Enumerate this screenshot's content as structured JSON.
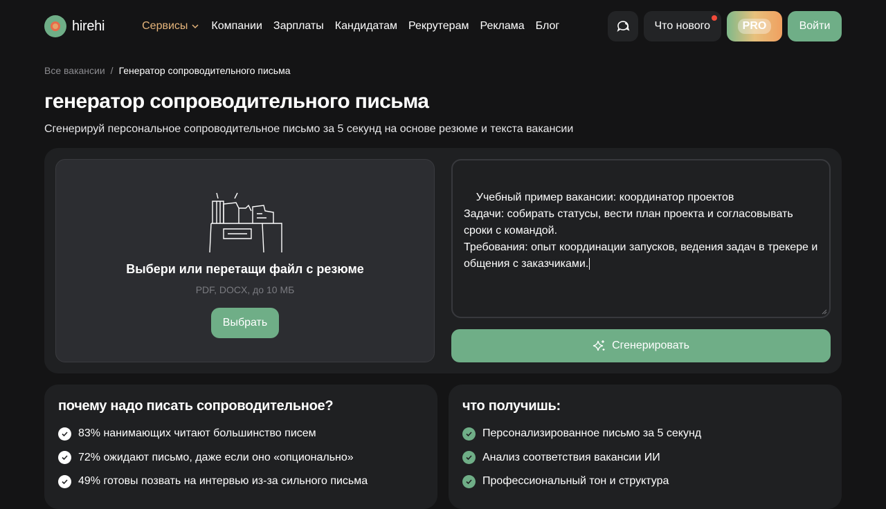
{
  "header": {
    "logo_text": "hirehi",
    "nav": [
      {
        "label": "Сервисы",
        "active": true
      },
      {
        "label": "Компании"
      },
      {
        "label": "Зарплаты"
      },
      {
        "label": "Кандидатам"
      },
      {
        "label": "Рекрутерам"
      },
      {
        "label": "Реклама"
      },
      {
        "label": "Блог"
      }
    ],
    "whats_new": "Что нового",
    "pro": "PRO",
    "login": "Войти"
  },
  "breadcrumb": {
    "parent": "Все вакансии",
    "separator": "/",
    "current": "Генератор сопроводительного письма"
  },
  "page": {
    "title": "генератор сопроводительного письма",
    "subtitle": "Сгенерируй персональное сопроводительное письмо за 5 секунд на основе резюме и текста вакансии"
  },
  "upload": {
    "title": "Выбери или перетащи файл с резюме",
    "hint": "PDF, DOCX, до 10 МБ",
    "button": "Выбрать"
  },
  "vacancy": {
    "text": "Учебный пример вакансии: координатор проектов\nЗадачи: собирать статусы, вести план проекта и согласовывать сроки с командой.\nТребования: опыт координации запусков, ведения задач в трекере и общения с заказчиками.",
    "generate_button": "Сгенерировать"
  },
  "why": {
    "title": "почему надо писать сопроводительное?",
    "items": [
      "83% нанимающих читают большинство писем",
      "72% ожидают письмо, даже если оно «опционально»",
      "49% готовы позвать на интервью из-за сильного письма"
    ]
  },
  "benefits": {
    "title": "что получишь:",
    "items": [
      "Персонализированное письмо за 5 секунд",
      "Анализ соответствия вакансии ИИ",
      "Профессиональный тон и структура"
    ]
  },
  "colors": {
    "background": "#141415",
    "accent": "#6fae87",
    "services": "#e6b57b",
    "notification": "#f04a3a"
  }
}
